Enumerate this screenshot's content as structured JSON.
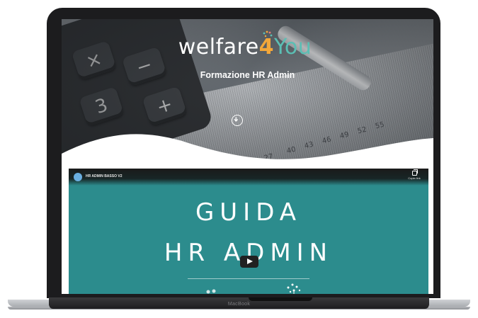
{
  "device": {
    "label": "MacBook"
  },
  "hero": {
    "brand_main": "welfare",
    "brand_four": "4",
    "brand_you": "You",
    "subtitle": "Formazione HR Admin",
    "ruler_numbers": [
      "27",
      "40",
      "43",
      "46",
      "49",
      "52",
      "55"
    ]
  },
  "calculator": {
    "keys": [
      "×",
      "−",
      "+",
      "3"
    ]
  },
  "video": {
    "title": "HR ADMIN BASSO V2",
    "copy_label": "Copia link",
    "line1": "GUIDA",
    "line2": "HR ADMIN"
  },
  "colors": {
    "teal": "#2c8c8d",
    "brand_orange": "#f3a73a",
    "brand_teal": "#5bbfb4"
  }
}
